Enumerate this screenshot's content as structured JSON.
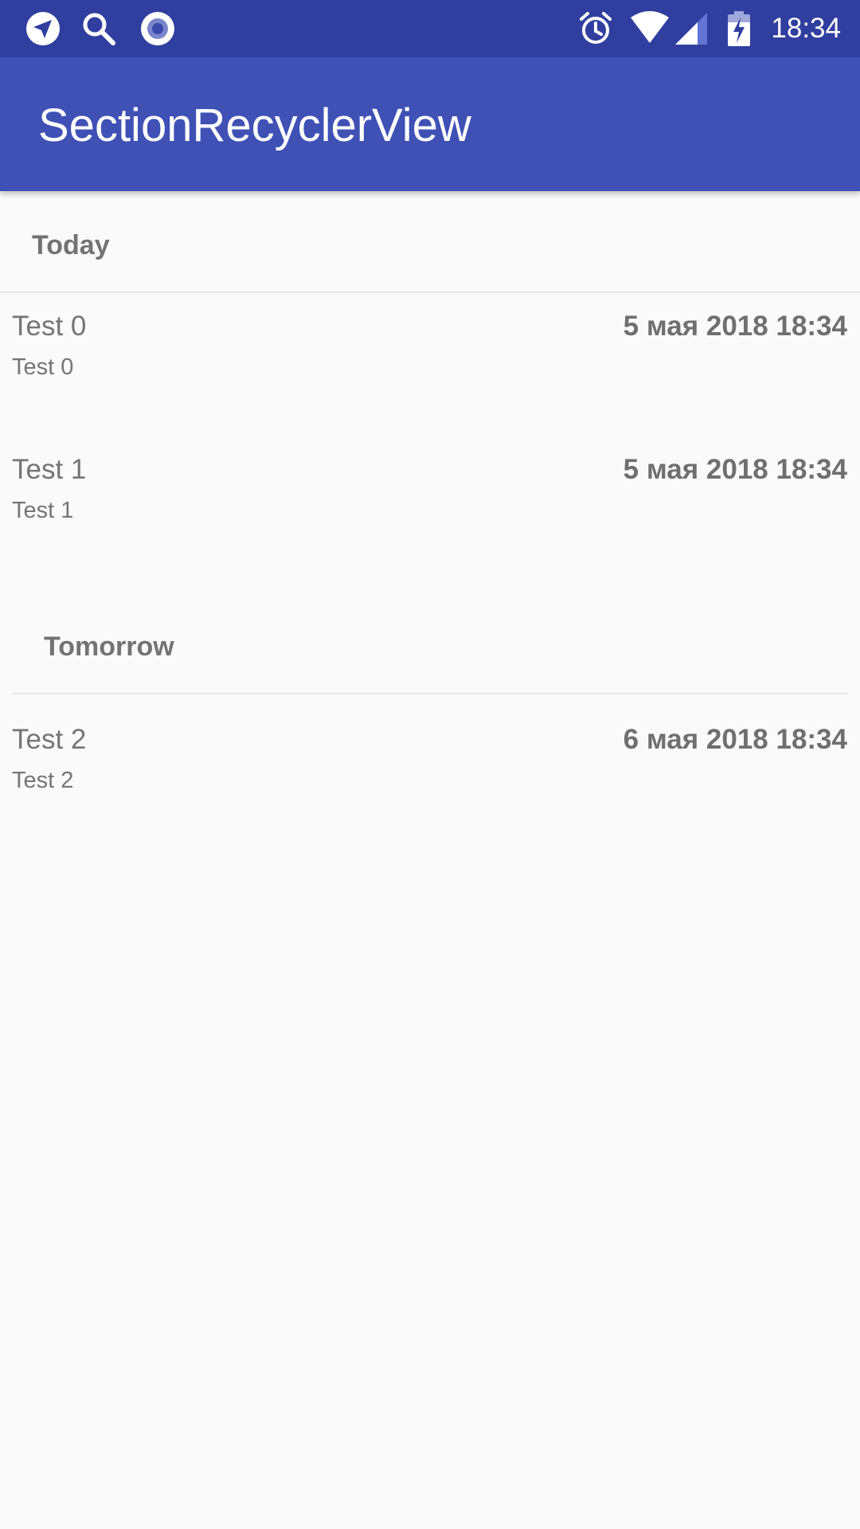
{
  "status_bar": {
    "time": "18:34",
    "left_icons": [
      "navigation-icon",
      "search-icon",
      "record-icon"
    ],
    "right_icons": [
      "alarm-icon",
      "wifi-icon",
      "signal-icon",
      "battery-charging-icon"
    ]
  },
  "app_bar": {
    "title": "SectionRecyclerView"
  },
  "colors": {
    "status_bar": "#303f9f",
    "app_bar": "#3f51b5",
    "background": "#fafafa",
    "text": "#757575"
  },
  "sections": [
    {
      "header": "Today",
      "items": [
        {
          "title": "Test 0",
          "subtitle": "Test 0",
          "date": "5 мая 2018 18:34"
        },
        {
          "title": "Test 1",
          "subtitle": "Test 1",
          "date": "5 мая 2018 18:34"
        }
      ]
    },
    {
      "header": "Tomorrow",
      "items": [
        {
          "title": "Test 2",
          "subtitle": "Test 2",
          "date": "6 мая 2018 18:34"
        }
      ]
    }
  ]
}
